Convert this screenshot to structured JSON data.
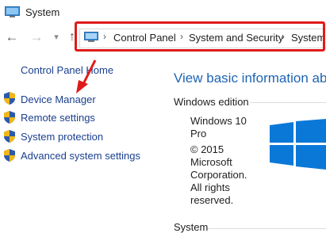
{
  "window": {
    "title": "System"
  },
  "address_bar": {
    "segments": [
      "Control Panel",
      "System and Security",
      "System"
    ],
    "icon": "control-panel-icon"
  },
  "sidebar": {
    "home_label": "Control Panel Home",
    "items": [
      {
        "label": "Device Manager",
        "icon": "uac-shield-icon"
      },
      {
        "label": "Remote settings",
        "icon": "uac-shield-icon"
      },
      {
        "label": "System protection",
        "icon": "uac-shield-icon"
      },
      {
        "label": "Advanced system settings",
        "icon": "uac-shield-icon"
      }
    ]
  },
  "main": {
    "heading": "View basic information abou",
    "edition_section": {
      "label": "Windows edition",
      "lines": [
        "Windows 10",
        "Pro",
        "© 2015",
        "Microsoft",
        "Corporation.",
        "All rights",
        "reserved."
      ]
    },
    "system_section": {
      "label": "System"
    }
  },
  "annotation": {
    "color": "#e01a1a"
  },
  "colors": {
    "link": "#1a3f8f",
    "heading": "#1e64b4",
    "windows_logo": "#0a78d7"
  }
}
